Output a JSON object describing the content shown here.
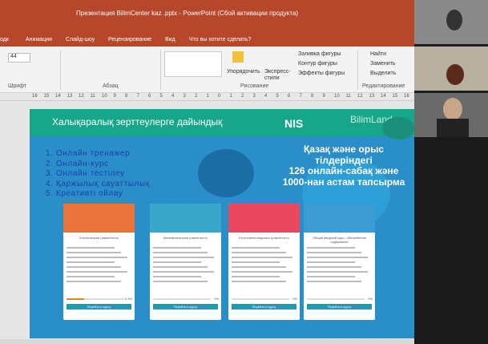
{
  "window": {
    "title": "Презентация BilimCenter kaz .pptx - PowerPoint (Сбой активации продукта)"
  },
  "menu": [
    "одк",
    "Анимация",
    "Слайд-шоу",
    "Рецензирование",
    "Вид",
    "Что вы хотите сделать?"
  ],
  "ribbon": {
    "font_size": "44",
    "groups": [
      "Шрифт",
      "Абзац",
      "Рисование",
      "Редактирование"
    ],
    "arrange": "Упорядочить",
    "express": "Экспресс-стили",
    "fill": "Заливка фигуры",
    "outline": "Контур фигуры",
    "effects": "Эффекты фигуры",
    "find": "Найти",
    "replace": "Заменить",
    "select": "Выделить"
  },
  "ruler": [
    "16",
    "15",
    "14",
    "13",
    "12",
    "11",
    "10",
    "9",
    "8",
    "7",
    "6",
    "5",
    "4",
    "3",
    "2",
    "1",
    "0",
    "1",
    "2",
    "3",
    "4",
    "5",
    "6",
    "7",
    "8",
    "9",
    "10",
    "11",
    "12",
    "13",
    "14",
    "15",
    "16"
  ],
  "slide": {
    "title": "Халықаралық зерттеулерге дайындық",
    "logo_nis": "NIS",
    "logo_bl": "BilimLand",
    "list": [
      "1.  Онлайн тренажер",
      "2.  Онлайн-курс",
      "3.  Онлайн тестілеу",
      "4.  Қаржылық сауаттылық",
      "5.  Креативті ойлау"
    ],
    "headline": [
      "Қазақ және орыс",
      "тілдеріндегі",
      "126 онлайн-сабақ және",
      "1000-нан астам тапсырма"
    ],
    "cards": [
      {
        "title": "Читательская грамотность",
        "progress": 0.3,
        "pct": "0,3%",
        "button": "Перейти к курсу",
        "img": "#e9743b"
      },
      {
        "title": "Математическая грамотность",
        "progress": 0,
        "pct": "0%",
        "button": "Перейти к курсу",
        "img": "#3aa7c9"
      },
      {
        "title": "Естественнонаучная грамотность",
        "progress": 0,
        "pct": "0%",
        "button": "Перейти к курсу",
        "img": "#e9485f"
      },
      {
        "title": "Общий вводный курс / обновлённое содержание",
        "progress": 0,
        "pct": "0%",
        "button": "Перейти к курсу",
        "img": "#3c9bd2"
      }
    ]
  }
}
